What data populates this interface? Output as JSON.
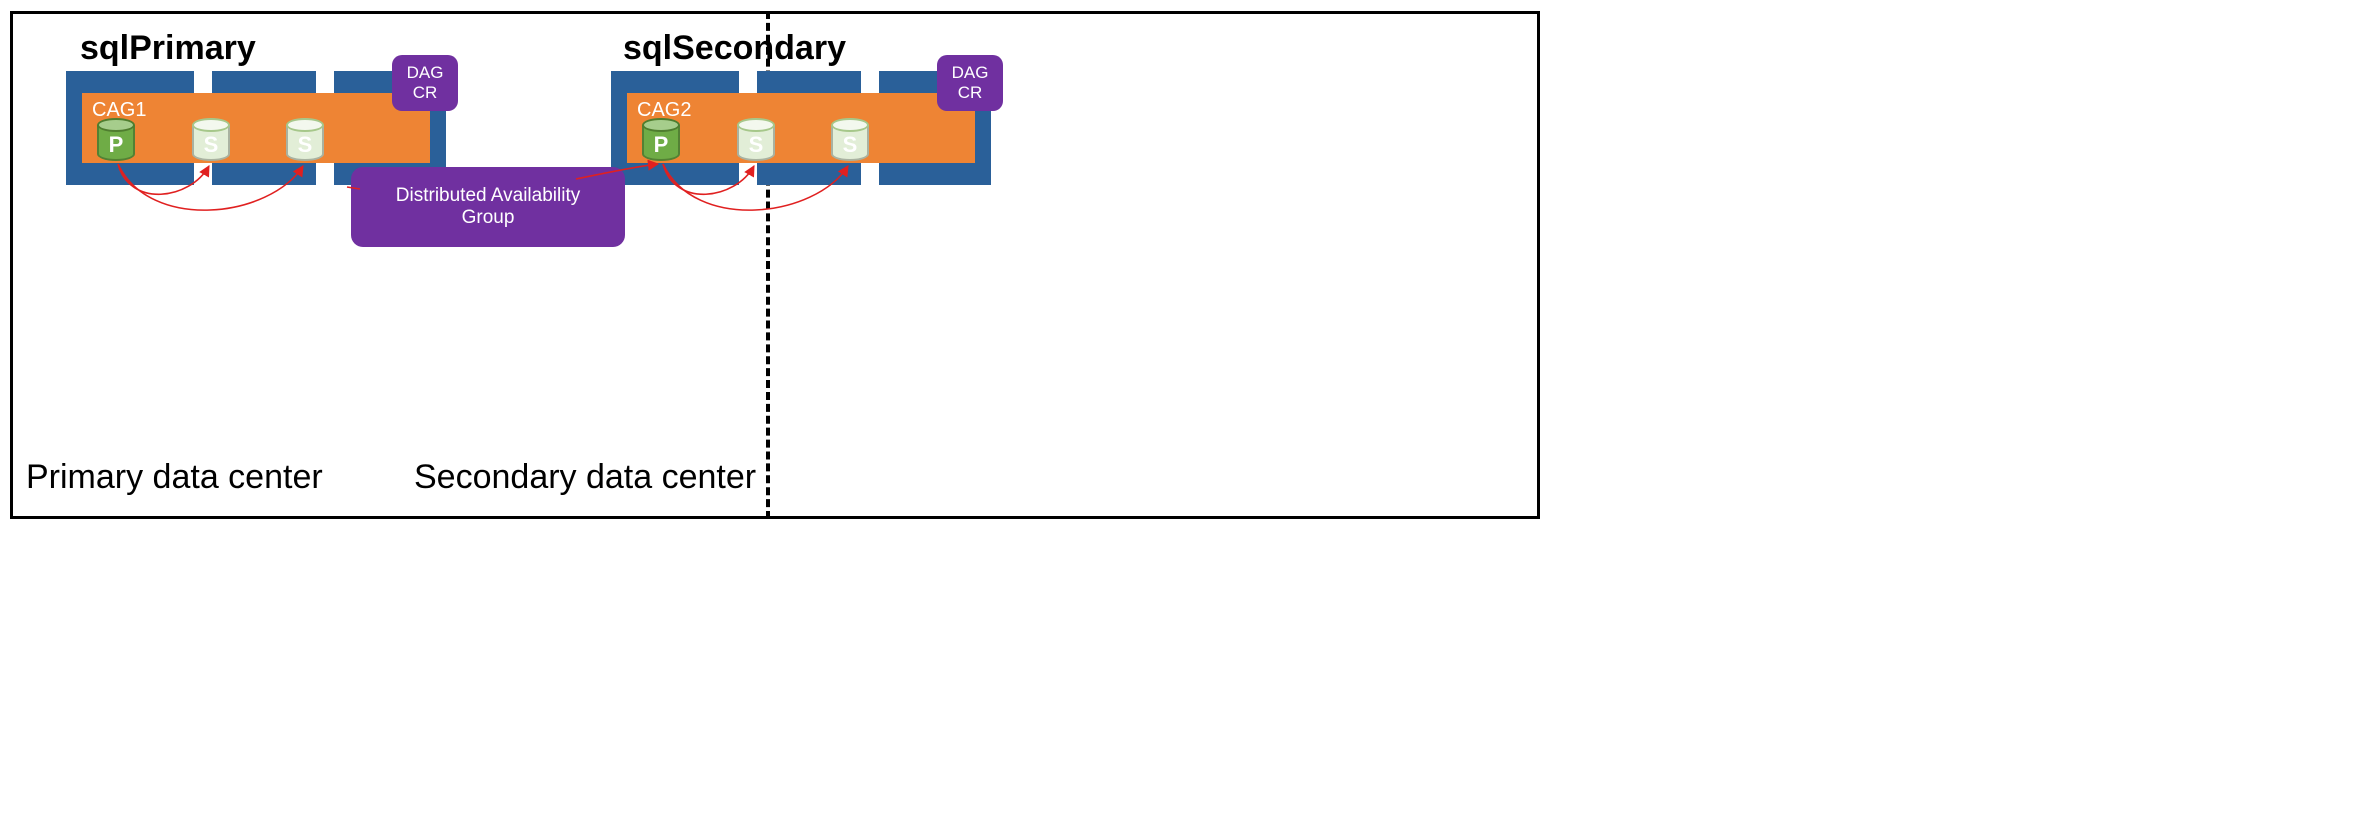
{
  "diagram": {
    "primary": {
      "datacenter_title": "Primary data center",
      "cluster_name": "sqlPrimary",
      "cag_label": "CAG1",
      "dag_badge_line1": "DAG",
      "dag_badge_line2": "CR",
      "nodes": {
        "p": "P",
        "s1": "S",
        "s2": "S"
      }
    },
    "secondary": {
      "datacenter_title": "Secondary data center",
      "cluster_name": "sqlSecondary",
      "cag_label": "CAG2",
      "dag_badge_line1": "DAG",
      "dag_badge_line2": "CR",
      "nodes": {
        "p": "P",
        "s1": "S",
        "s2": "S"
      }
    },
    "dag_group_label": "Distributed Availability Group"
  },
  "colors": {
    "blue": "#2A6099",
    "orange": "#EE8434",
    "purple": "#7030A0",
    "p_fill": "#6FAC46",
    "s_fill": "#E2EED7",
    "arrow": "#E02020"
  }
}
